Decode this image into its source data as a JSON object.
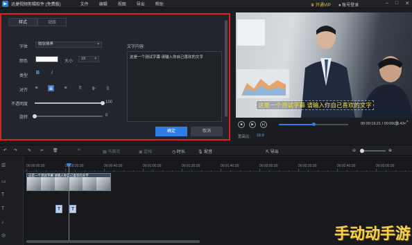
{
  "titlebar": {
    "app_title": "迅捷视频剪辑软件 (免费版)",
    "menu": [
      "文件",
      "编辑",
      "视图",
      "导出",
      "帮助"
    ],
    "vip": "开通VIP",
    "account": "账号登录",
    "window_buttons": [
      "minimize-icon",
      "maximize-icon",
      "close-icon"
    ]
  },
  "editor": {
    "tabs": [
      "样式",
      "动效"
    ],
    "active_tab": "样式",
    "font_label": "字体",
    "font_value": "微软雅黑",
    "color_label": "颜色",
    "color_value": "#ffffff",
    "size_label": "大小",
    "size_value": "19",
    "type_label": "类型",
    "type_icons": [
      "bold-icon",
      "italic-icon"
    ],
    "align_label": "对齐",
    "align_icons": [
      "align-left-icon",
      "align-center-icon",
      "align-right-icon",
      "align-top-icon",
      "align-middle-icon",
      "align-bottom-icon"
    ],
    "active_align": 1,
    "opacity_label": "不透明度",
    "opacity_value": "100",
    "opacity_fraction": 1.0,
    "rotate_label": "旋转",
    "rotate_value": "0",
    "rotate_fraction": 0.0,
    "content_label": "文字内容:",
    "content_value": "这是一个测试字幕 请输入你自己喜欢的文字",
    "ok_label": "确定",
    "cancel_label": "取消"
  },
  "preview": {
    "subtitle_text": "这是一个测试字幕 请输入你自己喜欢的文字",
    "time": "00:00:19.21 / 00:00:38.43",
    "progress_fraction": 0.5,
    "ratio_label": "宽高比:",
    "ratio_value": "16:9",
    "control_icons": [
      "stop-icon",
      "play-icon",
      "next-frame-icon"
    ],
    "right_icons": [
      "volume-icon",
      "fullscreen-icon"
    ]
  },
  "toolbar": {
    "items": [
      {
        "icon": "undo-icon",
        "label": "",
        "dim": false
      },
      {
        "icon": "redo-icon",
        "label": "",
        "dim": false
      },
      {
        "icon": "edit-icon",
        "label": "",
        "dim": false
      },
      {
        "icon": "cut-icon",
        "label": "",
        "dim": false
      },
      {
        "icon": "delete-icon",
        "label": "",
        "dim": false
      },
      {
        "icon": "crop-icon",
        "label": "",
        "dim": true
      },
      {
        "icon": "mosaic-icon",
        "label": "马赛克",
        "dim": true
      },
      {
        "icon": "freeze-icon",
        "label": "定格",
        "dim": true
      },
      {
        "icon": "duration-icon",
        "label": "时长",
        "dim": false
      },
      {
        "icon": "mic-icon",
        "label": "配音",
        "dim": false
      },
      {
        "icon": "export-icon",
        "label": "导出",
        "dim": false
      }
    ],
    "zoom_time": "00:00:00.00"
  },
  "timeline": {
    "ticks": [
      "00:00:00.00",
      "00:00:20.00",
      "00:00:40.00",
      "00:01:00.00",
      "00:01:20.00",
      "00:01:40.00",
      "00:02:00.00",
      "00:02:20.00",
      "00:02:40.00",
      "00:03:00.00"
    ],
    "clip_name": "这是一个测试字幕 请输入你自己喜欢的文字",
    "text_clips": [
      "T",
      "T"
    ],
    "track_icons": [
      "video-track-icon",
      "text-track-icon",
      "text-track-icon",
      "music-track-icon",
      "record-track-icon"
    ]
  },
  "watermark": "手动动手游"
}
